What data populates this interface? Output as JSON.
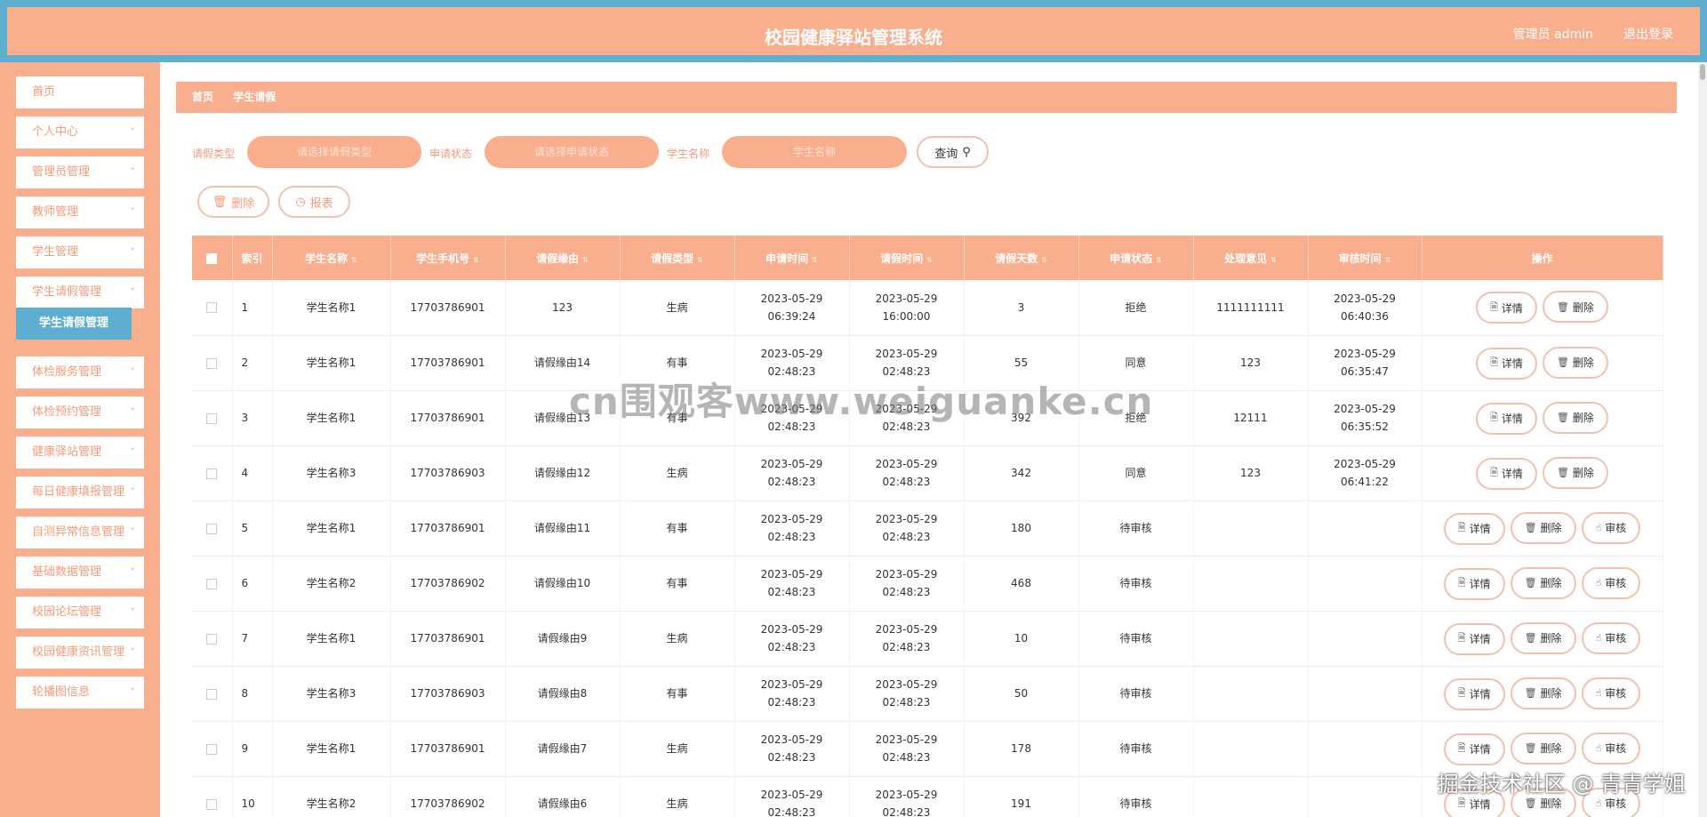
{
  "header": {
    "title": "校园健康驿站管理系统",
    "admin_label": "管理员 admin",
    "logout_label": "退出登录"
  },
  "sidebar": {
    "items": [
      {
        "label": "首页",
        "has_chevron": false
      },
      {
        "label": "个人中心",
        "has_chevron": true
      },
      {
        "label": "管理员管理",
        "has_chevron": true
      },
      {
        "label": "教师管理",
        "has_chevron": true
      },
      {
        "label": "学生管理",
        "has_chevron": true
      },
      {
        "label": "学生请假管理",
        "has_chevron": true
      },
      {
        "label": "体检服务管理",
        "has_chevron": true
      },
      {
        "label": "体检预约管理",
        "has_chevron": true
      },
      {
        "label": "健康驿站管理",
        "has_chevron": true
      },
      {
        "label": "每日健康填报管理",
        "has_chevron": true
      },
      {
        "label": "自测异常信息管理",
        "has_chevron": true
      },
      {
        "label": "基础数据管理",
        "has_chevron": true
      },
      {
        "label": "校园论坛管理",
        "has_chevron": true
      },
      {
        "label": "校园健康资讯管理",
        "has_chevron": true
      },
      {
        "label": "轮播图信息",
        "has_chevron": true
      }
    ],
    "active_sub": "学生请假管理"
  },
  "breadcrumb": [
    "首页",
    "学生请假"
  ],
  "search": {
    "leave_type_label": "请假类型",
    "leave_type_placeholder": "请选择请假类型",
    "status_label": "申请状态",
    "status_placeholder": "请选择申请状态",
    "student_label": "学生名称",
    "student_placeholder": "学生名称",
    "query_label": "查询"
  },
  "toolbar": {
    "delete_label": "删除",
    "report_label": "报表"
  },
  "table": {
    "columns": [
      "索引",
      "学生名称",
      "学生手机号",
      "请假缘由",
      "请假类型",
      "申请时间",
      "请假时间",
      "请假天数",
      "申请状态",
      "处理意见",
      "审核时间",
      "操作"
    ],
    "rows": [
      {
        "index": "1",
        "name": "学生名称1",
        "phone": "17703786901",
        "reason": "123",
        "type": "生病",
        "apply_time": "2023-05-29 06:39:24",
        "leave_time": "2023-05-29 16:00:00",
        "days": "3",
        "status": "拒绝",
        "opinion": "1111111111",
        "review_time": "2023-05-29 06:40:36",
        "actions": [
          "详情",
          "删除"
        ]
      },
      {
        "index": "2",
        "name": "学生名称1",
        "phone": "17703786901",
        "reason": "请假缘由14",
        "type": "有事",
        "apply_time": "2023-05-29 02:48:23",
        "leave_time": "2023-05-29 02:48:23",
        "days": "55",
        "status": "同意",
        "opinion": "123",
        "review_time": "2023-05-29 06:35:47",
        "actions": [
          "详情",
          "删除"
        ]
      },
      {
        "index": "3",
        "name": "学生名称1",
        "phone": "17703786901",
        "reason": "请假缘由13",
        "type": "有事",
        "apply_time": "2023-05-29 02:48:23",
        "leave_time": "2023-05-29 02:48:23",
        "days": "392",
        "status": "拒绝",
        "opinion": "12111",
        "review_time": "2023-05-29 06:35:52",
        "actions": [
          "详情",
          "删除"
        ]
      },
      {
        "index": "4",
        "name": "学生名称3",
        "phone": "17703786903",
        "reason": "请假缘由12",
        "type": "生病",
        "apply_time": "2023-05-29 02:48:23",
        "leave_time": "2023-05-29 02:48:23",
        "days": "342",
        "status": "同意",
        "opinion": "123",
        "review_time": "2023-05-29 06:41:22",
        "actions": [
          "详情",
          "删除"
        ]
      },
      {
        "index": "5",
        "name": "学生名称1",
        "phone": "17703786901",
        "reason": "请假缘由11",
        "type": "有事",
        "apply_time": "2023-05-29 02:48:23",
        "leave_time": "2023-05-29 02:48:23",
        "days": "180",
        "status": "待审核",
        "opinion": "",
        "review_time": "",
        "actions": [
          "详情",
          "删除",
          "审核"
        ]
      },
      {
        "index": "6",
        "name": "学生名称2",
        "phone": "17703786902",
        "reason": "请假缘由10",
        "type": "有事",
        "apply_time": "2023-05-29 02:48:23",
        "leave_time": "2023-05-29 02:48:23",
        "days": "468",
        "status": "待审核",
        "opinion": "",
        "review_time": "",
        "actions": [
          "详情",
          "删除",
          "审核"
        ]
      },
      {
        "index": "7",
        "name": "学生名称1",
        "phone": "17703786901",
        "reason": "请假缘由9",
        "type": "生病",
        "apply_time": "2023-05-29 02:48:23",
        "leave_time": "2023-05-29 02:48:23",
        "days": "10",
        "status": "待审核",
        "opinion": "",
        "review_time": "",
        "actions": [
          "详情",
          "删除",
          "审核"
        ]
      },
      {
        "index": "8",
        "name": "学生名称3",
        "phone": "17703786903",
        "reason": "请假缘由8",
        "type": "有事",
        "apply_time": "2023-05-29 02:48:23",
        "leave_time": "2023-05-29 02:48:23",
        "days": "50",
        "status": "待审核",
        "opinion": "",
        "review_time": "",
        "actions": [
          "详情",
          "删除",
          "审核"
        ]
      },
      {
        "index": "9",
        "name": "学生名称1",
        "phone": "17703786901",
        "reason": "请假缘由7",
        "type": "生病",
        "apply_time": "2023-05-29 02:48:23",
        "leave_time": "2023-05-29 02:48:23",
        "days": "178",
        "status": "待审核",
        "opinion": "",
        "review_time": "",
        "actions": [
          "详情",
          "删除",
          "审核"
        ]
      },
      {
        "index": "10",
        "name": "学生名称2",
        "phone": "17703786902",
        "reason": "请假缘由6",
        "type": "生病",
        "apply_time": "2023-05-29 02:48:23",
        "leave_time": "2023-05-29 02:48:23",
        "days": "191",
        "status": "待审核",
        "opinion": "",
        "review_time": "",
        "actions": [
          "详情",
          "删除",
          "审核"
        ]
      }
    ]
  },
  "watermark": "cn围观客www.weiguanke.cn",
  "credit": "掘金技术社区 @ 青青学姐",
  "colors": {
    "accent": "#f9ae8e",
    "border_blue": "#5eaecf",
    "label_orange": "#f39c79"
  }
}
